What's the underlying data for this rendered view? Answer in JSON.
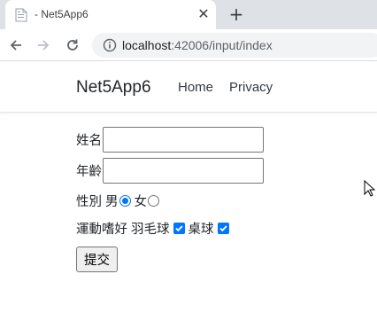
{
  "browser": {
    "tab_title": "- Net5App6",
    "close_glyph": "✕",
    "new_tab_glyph": "+",
    "url_host": "localhost",
    "url_path": ":42006/input/index"
  },
  "navbar": {
    "brand": "Net5App6",
    "links": [
      {
        "label": "Home"
      },
      {
        "label": "Privacy"
      }
    ]
  },
  "form": {
    "name_label": "姓名",
    "name_value": "",
    "age_label": "年齡",
    "age_value": "",
    "gender_label": "性別",
    "gender_options": [
      {
        "label": "男",
        "checked": true
      },
      {
        "label": "女",
        "checked": false
      }
    ],
    "hobby_label": "運動嗜好",
    "hobby_options": [
      {
        "label": "羽毛球",
        "checked": true
      },
      {
        "label": "桌球",
        "checked": true
      }
    ],
    "submit_label": "提交"
  },
  "colors": {
    "accent": "#0075ff",
    "tabstrip": "#dee1e6",
    "omnibox": "#f1f3f4"
  }
}
